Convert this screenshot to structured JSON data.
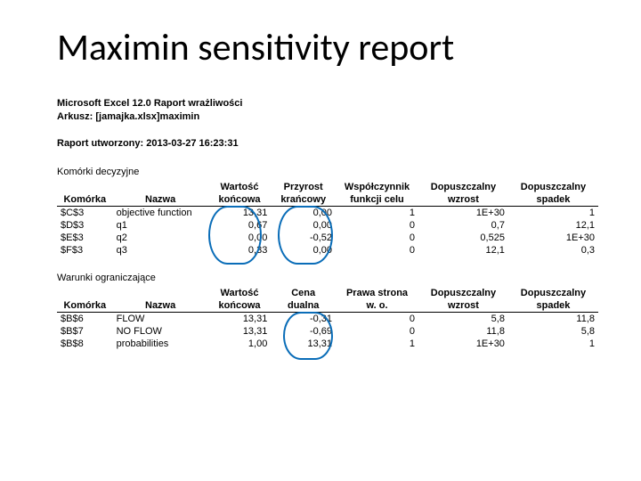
{
  "title": "Maximin sensitivity report",
  "meta": {
    "line1": "Microsoft Excel 12.0 Raport wrażliwości",
    "line2": "Arkusz: [jamajka.xlsx]maximin",
    "line3": "Raport utworzony: 2013-03-27 16:23:31"
  },
  "section1_label": "Komórki decyzyjne",
  "section2_label": "Warunki ograniczające",
  "head1": {
    "top": [
      "",
      "",
      "Wartość",
      "Przyrost",
      "Współczynnik",
      "Dopuszczalny",
      "Dopuszczalny"
    ],
    "bot": [
      "Komórka",
      "Nazwa",
      "końcowa",
      "krańcowy",
      "funkcji celu",
      "wzrost",
      "spadek"
    ]
  },
  "rows1": [
    {
      "cell": "$C$3",
      "name": "objective function",
      "v": "13,31",
      "inc": "0,00",
      "coef": "1",
      "up": "1E+30",
      "dn": "1"
    },
    {
      "cell": "$D$3",
      "name": "q1",
      "v": "0,67",
      "inc": "0,00",
      "coef": "0",
      "up": "0,7",
      "dn": "12,1"
    },
    {
      "cell": "$E$3",
      "name": "q2",
      "v": "0,00",
      "inc": "-0,52",
      "coef": "0",
      "up": "0,525",
      "dn": "1E+30"
    },
    {
      "cell": "$F$3",
      "name": "q3",
      "v": "0,33",
      "inc": "0,00",
      "coef": "0",
      "up": "12,1",
      "dn": "0,3"
    }
  ],
  "head2": {
    "top": [
      "",
      "",
      "Wartość",
      "Cena",
      "Prawa strona",
      "Dopuszczalny",
      "Dopuszczalny"
    ],
    "bot": [
      "Komórka",
      "Nazwa",
      "końcowa",
      "dualna",
      "w. o.",
      "wzrost",
      "spadek"
    ]
  },
  "rows2": [
    {
      "cell": "$B$6",
      "name": "FLOW",
      "v": "13,31",
      "inc": "-0,31",
      "coef": "0",
      "up": "5,8",
      "dn": "11,8"
    },
    {
      "cell": "$B$7",
      "name": "NO FLOW",
      "v": "13,31",
      "inc": "-0,69",
      "coef": "0",
      "up": "11,8",
      "dn": "5,8"
    },
    {
      "cell": "$B$8",
      "name": "probabilities",
      "v": "1,00",
      "inc": "13,31",
      "coef": "1",
      "up": "1E+30",
      "dn": "1"
    }
  ]
}
